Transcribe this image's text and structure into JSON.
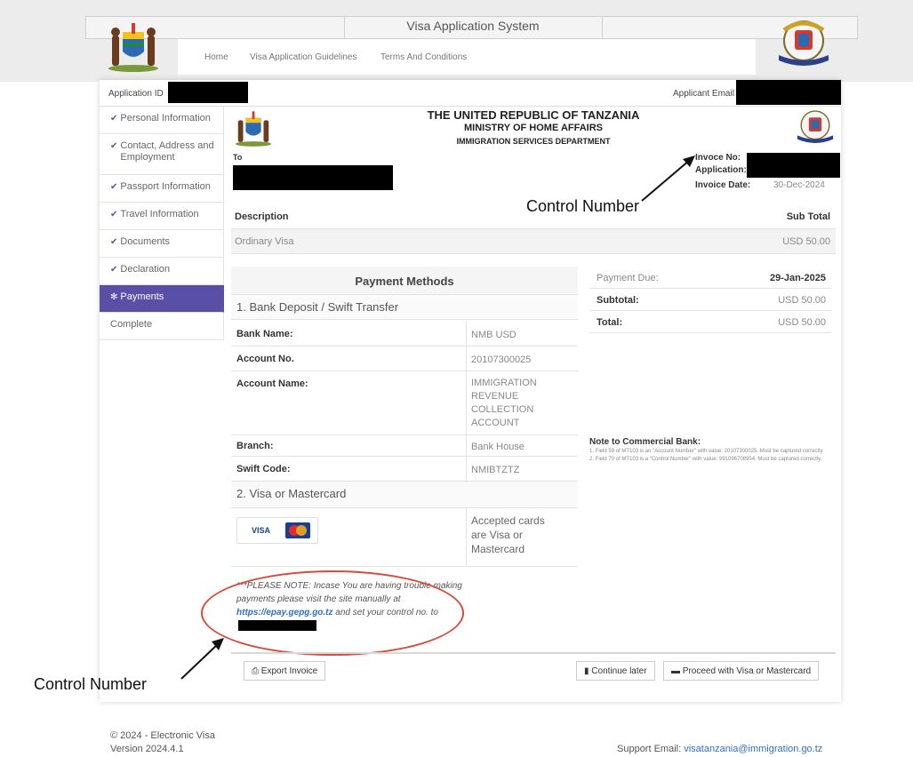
{
  "header": {
    "title": "Visa Application System",
    "nav": [
      "Home",
      "Visa Application Guidelines",
      "Terms And Conditions"
    ]
  },
  "idbar": {
    "application_id_label": "Application ID",
    "email_label": "Applicant Email"
  },
  "sidebar": {
    "items": [
      {
        "label": "Personal Information",
        "icon": "check-icon"
      },
      {
        "label": "Contact, Address and Employment",
        "icon": "check-icon"
      },
      {
        "label": "Passport Information",
        "icon": "check-icon"
      },
      {
        "label": "Travel Information",
        "icon": "check-icon"
      },
      {
        "label": "Documents",
        "icon": "check-icon"
      },
      {
        "label": "Declaration",
        "icon": "check-icon"
      },
      {
        "label": "Payments",
        "icon": "spinner-icon",
        "active": true
      },
      {
        "label": "Complete"
      }
    ],
    "active_color": "#5a4fa6"
  },
  "invoice": {
    "country": "THE UNITED REPUBLIC OF TANZANIA",
    "ministry": "MINISTRY OF HOME AFFAIRS",
    "department": "IMMIGRATION SERVICES DEPARTMENT",
    "to_label": "To",
    "invoice_no_label": "Invoce No:",
    "application_label": "Application:",
    "invoice_date_label": "Invoice Date:",
    "invoice_date": "30-Dec-2024",
    "col_description": "Description",
    "col_subtotal": "Sub Total",
    "line_item": "Ordinary Visa",
    "line_amount": "USD 50.00"
  },
  "payment_methods": {
    "title": "Payment Methods",
    "bank_section": "1. Bank Deposit / Swift Transfer",
    "rows": [
      {
        "label": "Bank Name:",
        "value": "NMB USD"
      },
      {
        "label": "Account No.",
        "value": "20107300025"
      },
      {
        "label": "Account Name:",
        "value": "IMMIGRATION REVENUE COLLECTION ACCOUNT"
      },
      {
        "label": "Branch:",
        "value": "Bank House"
      },
      {
        "label": "Swift Code:",
        "value": "NMIBTZTZ"
      }
    ],
    "card_section": "2. Visa or Mastercard",
    "accepted_cards": "Accepted cards are Visa or Mastercard",
    "visa_label": "VISA",
    "note_prefix": "***PLEASE NOTE: Incase You are having trouble making payments please visit the site manually at",
    "note_link": "https://epay.gepg.go.tz",
    "note_suffix": "and set your control no. to"
  },
  "summary": {
    "payment_due_label": "Payment Due:",
    "payment_due": "29-Jan-2025",
    "subtotal_label": "Subtotal:",
    "subtotal": "USD 50.00",
    "total_label": "Total:",
    "total": "USD 50.00"
  },
  "bank_note": {
    "title": "Note to Commercial Bank:",
    "items": [
      "1.  Field 59 of MT103 is an \"Account Number\" with value: 20107300025. Must be captured correctly.",
      "2.  Field 70 of MT103 is a \"Control Number\" with value: 991096708954. Must be captured correctly."
    ]
  },
  "actions": {
    "export": "Export Invoice",
    "continue_later": "Continue later",
    "proceed": "Proceed with Visa or Mastercard"
  },
  "annotations": {
    "top": "Control Number",
    "bottom": "Control Number"
  },
  "footer": {
    "copyright": "© 2024 - Electronic Visa",
    "version": "Version 2024.4.1",
    "support_label": "Support Email:",
    "support_email": "visatanzania@immigration.go.tz"
  }
}
